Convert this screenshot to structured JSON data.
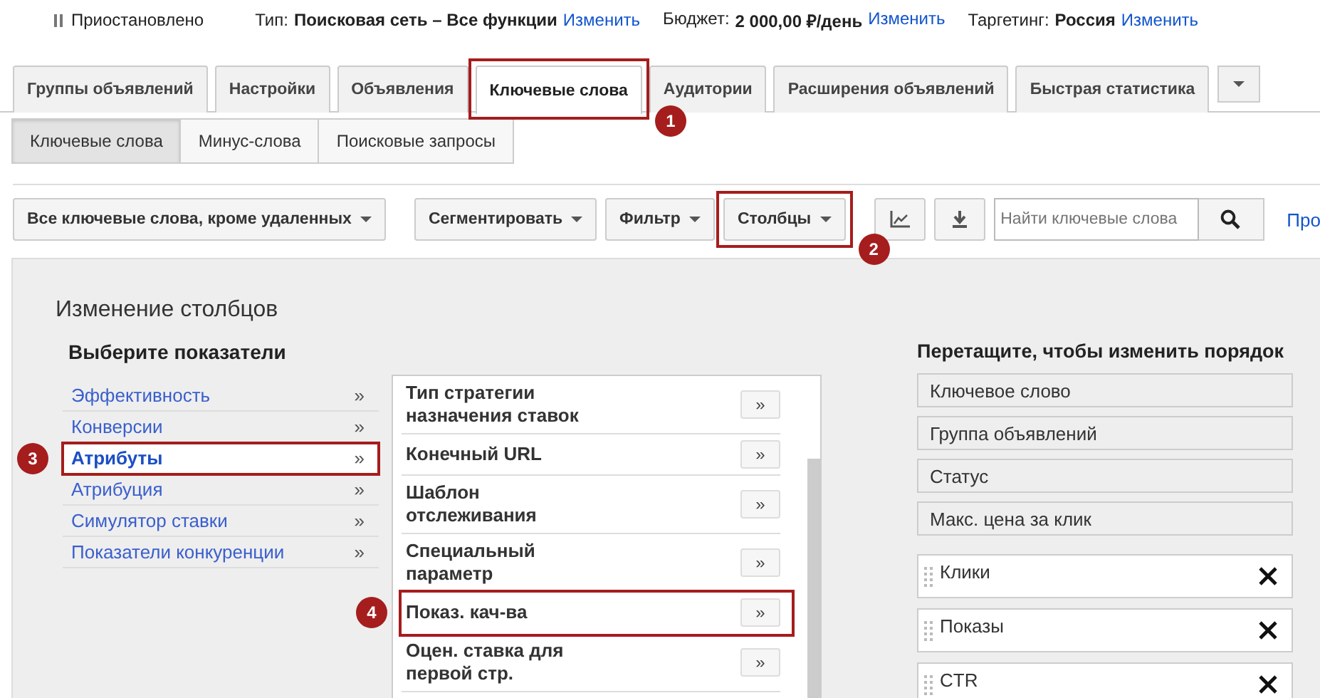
{
  "status_bar": {
    "state": "Приостановлено",
    "items": [
      {
        "label": "Тип:",
        "value": "Поисковая сеть – Все функции",
        "link": "Изменить"
      },
      {
        "label": "Бюджет:",
        "value": "2 000,00 ₽/день",
        "link": "Изменить"
      },
      {
        "label": "Таргетинг:",
        "value": "Россия",
        "link": "Изменить"
      }
    ]
  },
  "tabs": [
    {
      "label": "Группы объявлений",
      "selected": false,
      "highlighted": false
    },
    {
      "label": "Настройки",
      "selected": false,
      "highlighted": false
    },
    {
      "label": "Объявления",
      "selected": false,
      "highlighted": false
    },
    {
      "label": "Ключевые слова",
      "selected": true,
      "highlighted": true,
      "callout": "1"
    },
    {
      "label": "Аудитории",
      "selected": false,
      "highlighted": false
    },
    {
      "label": "Расширения объявлений",
      "selected": false,
      "highlighted": false
    },
    {
      "label": "Быстрая статистика",
      "selected": false,
      "highlighted": false
    }
  ],
  "subtabs": [
    {
      "label": "Ключевые слова",
      "selected": true
    },
    {
      "label": "Минус-слова",
      "selected": false
    },
    {
      "label": "Поисковые запросы",
      "selected": false
    }
  ],
  "toolbar": {
    "view_filter": "Все ключевые слова, кроме удаленных",
    "buttons": [
      {
        "label": "Сегментировать",
        "highlighted": false
      },
      {
        "label": "Фильтр",
        "highlighted": false
      },
      {
        "label": "Столбцы",
        "highlighted": true,
        "callout": "2"
      }
    ],
    "search": {
      "placeholder": "Найти ключевые слова"
    },
    "link": "Про"
  },
  "panel": {
    "title": "Изменение столбцов",
    "metrics_heading": "Выберите показатели",
    "categories": [
      {
        "label": "Эффективность",
        "arrow": "»",
        "selected": false,
        "highlighted": false
      },
      {
        "label": "Конверсии",
        "arrow": "»",
        "selected": false,
        "highlighted": false
      },
      {
        "label": "Атрибуты",
        "arrow": "»",
        "selected": true,
        "highlighted": true,
        "callout": "3"
      },
      {
        "label": "Атрибуция",
        "arrow": "»",
        "selected": false,
        "highlighted": false
      },
      {
        "label": "Симулятор ставки",
        "arrow": "»",
        "selected": false,
        "highlighted": false
      },
      {
        "label": "Показатели конкуренции",
        "arrow": "»",
        "selected": false,
        "highlighted": false
      }
    ],
    "metrics": [
      {
        "label": "Тип стратегии назначения ставок",
        "button": "»",
        "highlighted": false
      },
      {
        "label": "Конечный URL",
        "button": "»",
        "highlighted": false
      },
      {
        "label": "Шаблон отслеживания",
        "button": "»",
        "highlighted": false
      },
      {
        "label": "Специальный параметр",
        "button": "»",
        "highlighted": false
      },
      {
        "label": "Показ. кач-ва",
        "button": "»",
        "highlighted": true,
        "callout": "4"
      },
      {
        "label": "Оцен. ставка для первой стр.",
        "button": "»",
        "highlighted": false
      }
    ],
    "order_heading": "Перетащите, чтобы изменить порядок",
    "columns": [
      {
        "label": "Ключевое слово",
        "kind": "fixed"
      },
      {
        "label": "Группа объявлений",
        "kind": "fixed"
      },
      {
        "label": "Статус",
        "kind": "fixed"
      },
      {
        "label": "Макс. цена за клик",
        "kind": "fixed"
      },
      {
        "label": "Клики",
        "kind": "removable"
      },
      {
        "label": "Показы",
        "kind": "removable"
      },
      {
        "label": "CTR",
        "kind": "removable"
      }
    ]
  }
}
